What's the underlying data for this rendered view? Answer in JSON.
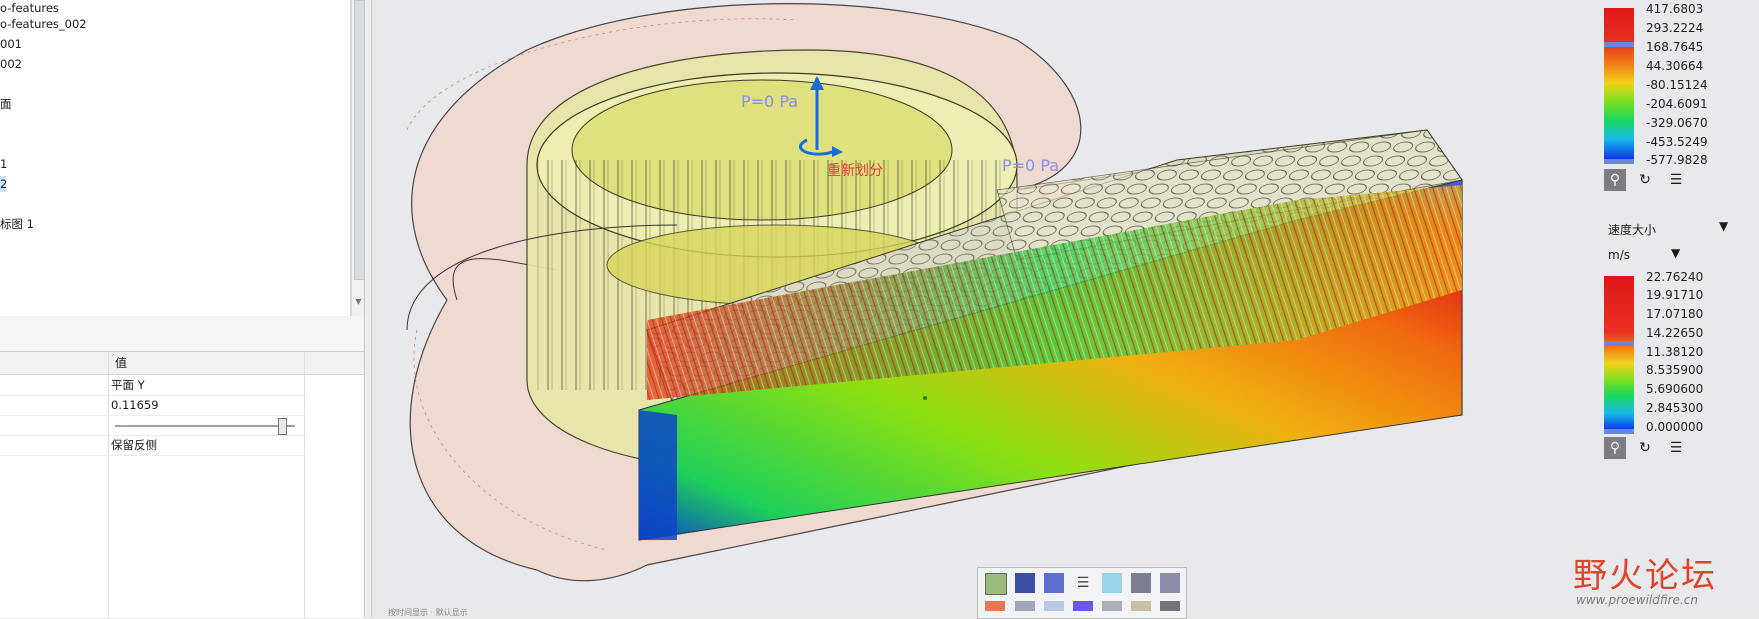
{
  "tree": {
    "items": [
      {
        "label": "o-features",
        "selected": false
      },
      {
        "label": "o-features_002",
        "selected": false
      },
      {
        "label": "001",
        "selected": false
      },
      {
        "label": "002",
        "selected": false
      },
      {
        "label": "面",
        "selected": false
      },
      {
        "label": "1",
        "selected": false
      },
      {
        "label": "2",
        "selected": true
      },
      {
        "label": "标图 1",
        "selected": false
      }
    ]
  },
  "props": {
    "header_value": "值",
    "rows": [
      {
        "value": "平面 Y"
      },
      {
        "value": "0.11659"
      },
      {
        "value": ""
      },
      {
        "value": "保留反侧"
      }
    ],
    "slider_fraction": 0.93
  },
  "legend_pressure": {
    "labels": [
      "417.6803",
      "293.2224",
      "168.7645",
      "44.30664",
      "-80.15124",
      "-204.6091",
      "-329.0670",
      "-453.5249",
      "-577.9828"
    ]
  },
  "legend_velocity": {
    "quantity": "速度大小",
    "unit": "m/s",
    "labels": [
      "22.76240",
      "19.91710",
      "17.07180",
      "14.22650",
      "11.38120",
      "8.535900",
      "5.690600",
      "2.845300",
      "0.000000"
    ]
  },
  "viewport": {
    "label_p0_left": "P=0 Pa",
    "label_p0_right": "P=0 Pa",
    "label_remesh": "重新划分",
    "status_text": "按时间显示 · 默认显示"
  },
  "watermark": {
    "text_cn": "野火论坛",
    "url": "www.proewildfire.cn"
  },
  "colors": {
    "selection": "#cde6f7",
    "viewport_bg": "#e7e9ec",
    "legend_blue_marker": "#6a86d8",
    "watermark_red": "#e0452b"
  }
}
